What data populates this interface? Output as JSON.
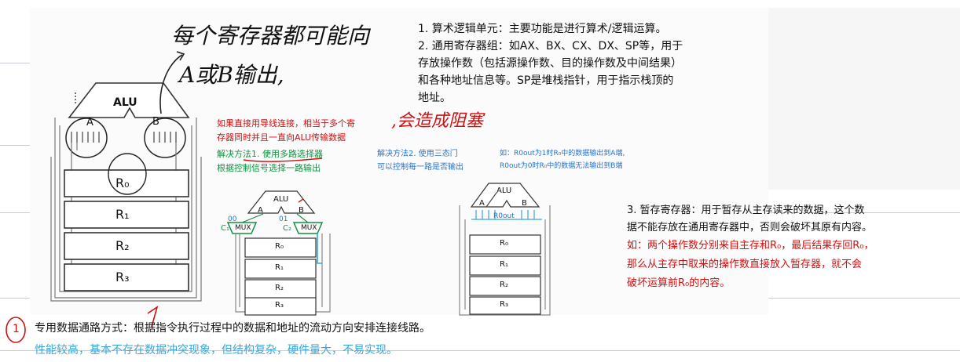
{
  "colors": {
    "red": "#d01010",
    "green": "#119040",
    "blue": "#2a73c9",
    "cyan": "#3aa6d8",
    "ink": "#222222"
  },
  "handnote_top": {
    "line1": "每个寄存器都可能向",
    "line2": "A或B输出,"
  },
  "handnote_red": ",会造成阻塞",
  "left_diagram": {
    "alu": "ALU",
    "a": "A",
    "b": "B",
    "registers": [
      "R₀",
      "R₁",
      "R₂",
      "R₃"
    ]
  },
  "points": {
    "p1": "1. 算术逻辑单元：主要功能是进行算术/逻辑运算。",
    "p2_lines": [
      "2. 通用寄存器组：如AX、BX、CX、DX、SP等，用于",
      "存放操作数（包括源操作数、目的操作数及中间结果）",
      "和各种地址信息等。SP是堆栈指针，用于指示栈顶的",
      "地址。"
    ],
    "p3_lines": [
      "3. 暂存寄存器：用于暂存从主存读来的数据，这个数",
      "据不能存放在通用寄存器中，否则会破坏其原有内容。"
    ],
    "p3_red_lines": [
      "如：两个操作数分别来自主存和R₀，最后结果存回R₀，",
      "那么从主存中取来的操作数直接放入暂存器，就不会",
      "破坏运算前R₀的内容。"
    ]
  },
  "problem": {
    "line1": "如果直接用导线连接，相当于多个寄",
    "line2": "存器同时并且一直向ALU传输数据"
  },
  "solution1": {
    "line1": "解决方法1. 使用多路选择器",
    "line2": "根据控制信号选择一路输出"
  },
  "solution2": {
    "line1": "解决方法2. 使用三态门",
    "line2": "可以控制每一路是否输出"
  },
  "example": {
    "line1": "如：R0out为1时R₀中的数据输出到A端,",
    "line2": "R0out为0时R₀中的数据无法输出到B端"
  },
  "mux_diagram": {
    "alu": "ALU",
    "a": "A",
    "b": "B",
    "c0": "00",
    "c1": "C₁",
    "mux": "MUX",
    "c2": "01",
    "c3": "C₂",
    "registers": [
      "R₀",
      "R₁",
      "R₂",
      "R₃"
    ]
  },
  "tri_diagram": {
    "alu": "ALU",
    "a": "A",
    "b": "B",
    "r0out": "R0out",
    "registers": [
      "R₀",
      "R₁",
      "R₂",
      "R₃"
    ]
  },
  "bottom": {
    "circle_num": "1",
    "main": "专用数据通路方式：根据指令执行过程中的数据和地址的流动方向安排连接线路。",
    "sub": "性能较高，基本不存在数据冲突现象，但结构复杂，硬件量大，不易实现。"
  }
}
